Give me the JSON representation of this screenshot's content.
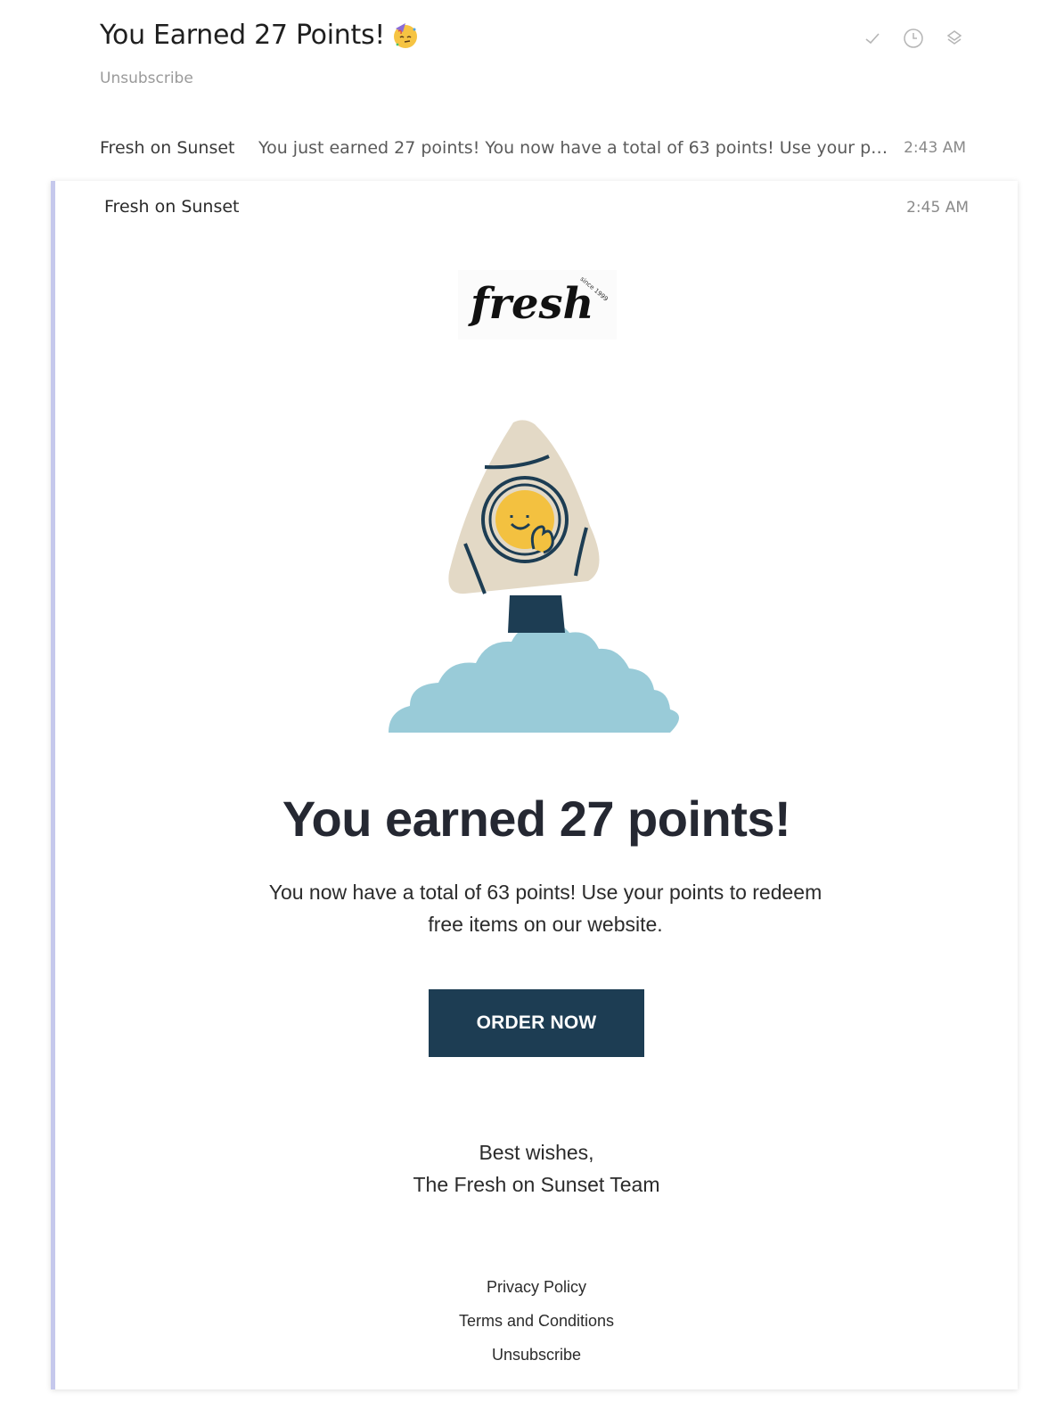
{
  "thread": {
    "subject": "You Earned 27 Points!",
    "subject_emoji": "partying-face-emoji",
    "unsubscribe_label": "Unsubscribe",
    "actions": [
      "check-icon",
      "clock-icon",
      "layers-icon"
    ]
  },
  "collapsed_message": {
    "sender": "Fresh on Sunset",
    "snippet": "You just earned 27 points! You now have a total of 63 points! Use your poi...",
    "time": "2:43 AM"
  },
  "open_message": {
    "sender": "Fresh on Sunset",
    "time": "2:45 AM"
  },
  "email": {
    "logo_text": "fresh",
    "logo_tag": "since 1999",
    "headline": "You earned 27 points!",
    "paragraph": "You now have a total of 63 points! Use your points to redeem free items on our website.",
    "cta_label": "ORDER NOW",
    "signoff_line1": "Best wishes,",
    "signoff_line2": "The Fresh on Sunset Team",
    "footer_links": [
      "Privacy Policy",
      "Terms and Conditions",
      "Unsubscribe"
    ]
  },
  "colors": {
    "card_accent": "#c5c8ec",
    "cta_bg": "#1d3d53",
    "rocket_body": "#e3d9c6",
    "rocket_navy": "#1d3d53",
    "cloud": "#99cbd8",
    "face": "#f3c140"
  }
}
